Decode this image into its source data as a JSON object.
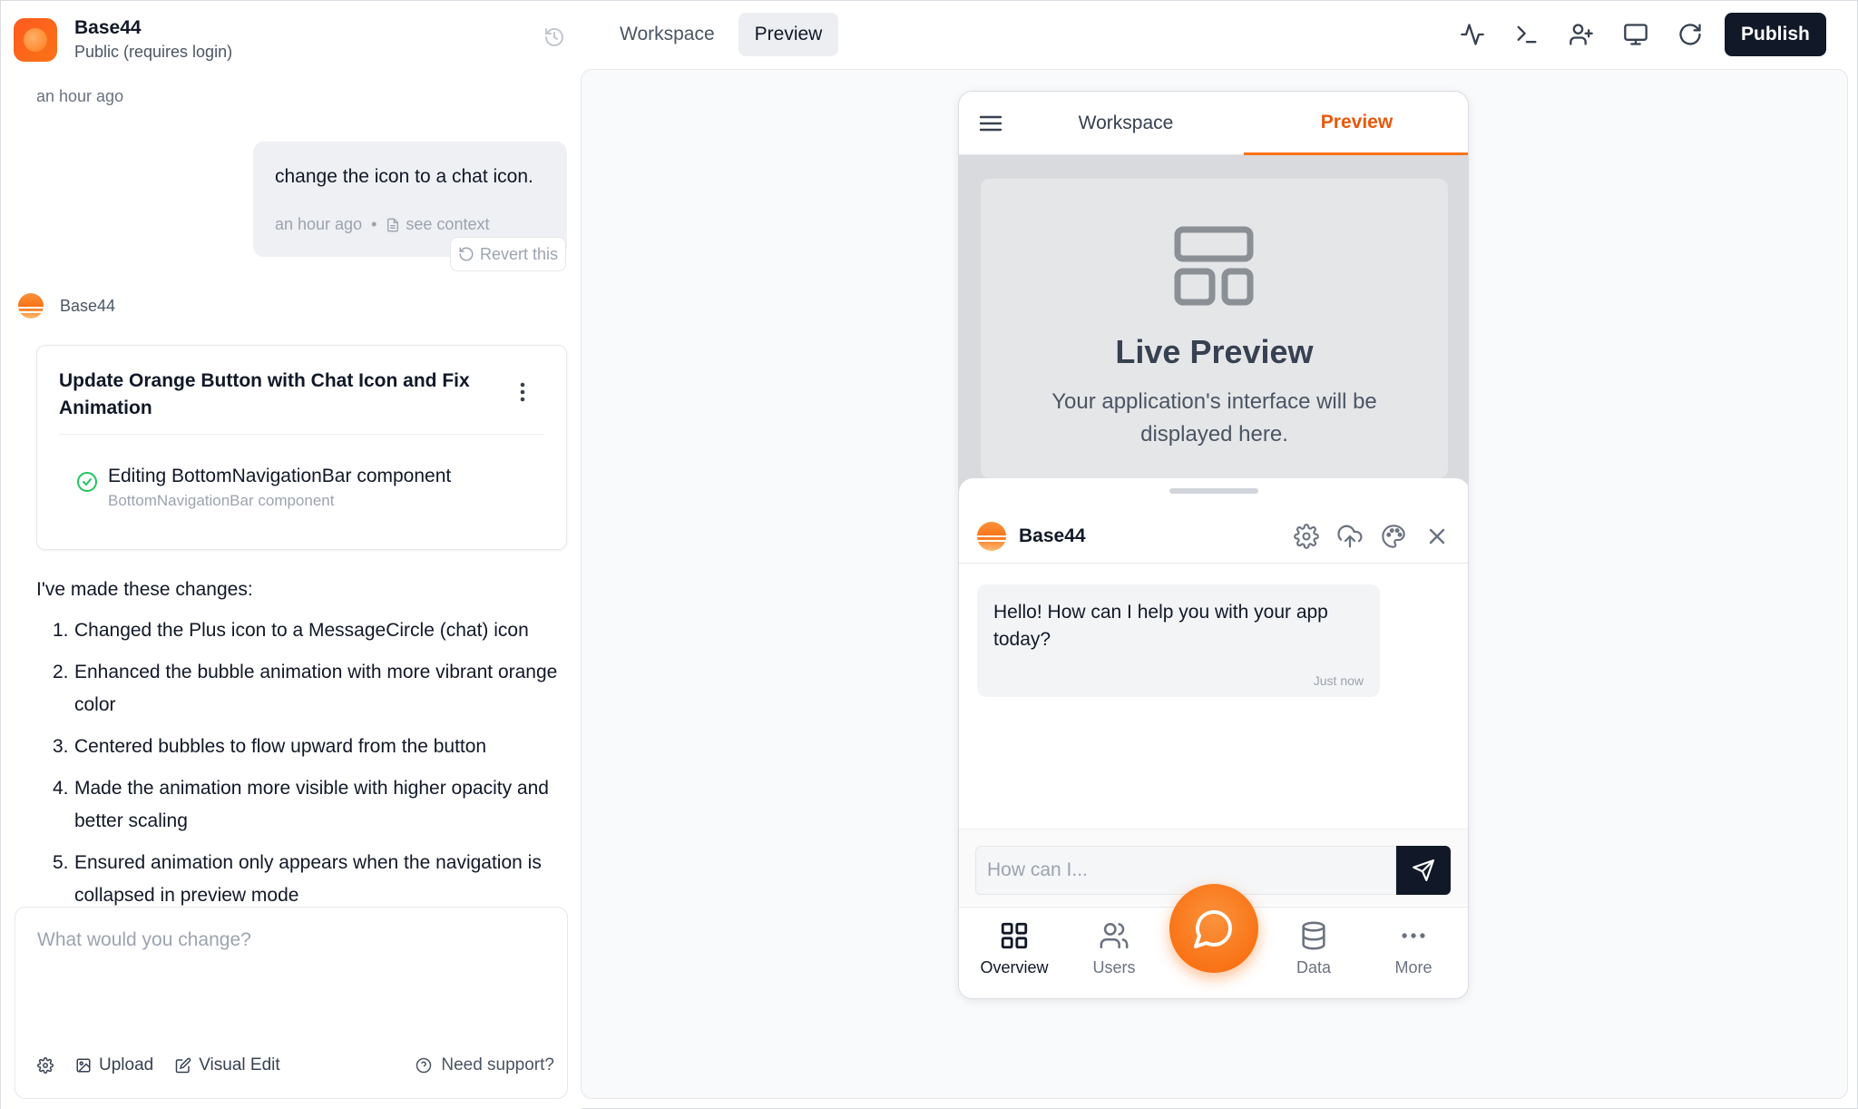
{
  "app": {
    "name": "Base44",
    "visibility": "Public (requires login)"
  },
  "topbar": {
    "tabs": [
      {
        "label": "Workspace",
        "active": false
      },
      {
        "label": "Preview",
        "active": true
      }
    ],
    "icons": [
      "activity-icon",
      "terminal-icon",
      "add-user-icon",
      "monitor-icon",
      "refresh-icon"
    ],
    "publish_label": "Publish"
  },
  "chat": {
    "timestamp_top": "an hour ago",
    "user_message": {
      "text": "change the icon to a chat icon.",
      "time": "an hour ago",
      "separator": "•",
      "context_label": "see context",
      "revert_label": "Revert this"
    },
    "bot": {
      "name": "Base44",
      "card": {
        "title": "Update Orange Button with Chat Icon and Fix Animation",
        "task": "Editing BottomNavigationBar component",
        "task_sub": "BottomNavigationBar component"
      },
      "intro": "I've made these changes:",
      "changes": [
        {
          "num": "1.",
          "text": "Changed the Plus icon to a MessageCircle (chat) icon"
        },
        {
          "num": "2.",
          "text": "Enhanced the bubble animation with more vibrant orange color"
        },
        {
          "num": "3.",
          "text": "Centered bubbles to flow upward from the button"
        },
        {
          "num": "4.",
          "text": "Made the animation more visible with higher opacity and better scaling"
        },
        {
          "num": "5.",
          "text": "Ensured animation only appears when the navigation is collapsed in preview mode"
        }
      ]
    }
  },
  "prompt": {
    "placeholder": "What would you change?",
    "upload_label": "Upload",
    "visual_edit_label": "Visual Edit",
    "support_label": "Need support?"
  },
  "phone": {
    "tabs": {
      "workspace": "Workspace",
      "preview": "Preview"
    },
    "live_preview": {
      "title": "Live Preview",
      "description": "Your application's interface will be displayed here."
    },
    "assistant": {
      "name": "Base44",
      "message": "Hello! How can I help you with your app today?",
      "message_time": "Just now",
      "input_placeholder": "How can I..."
    },
    "bottom_nav": [
      {
        "label": "Overview",
        "icon": "grid-icon",
        "active": true
      },
      {
        "label": "Users",
        "icon": "users-icon",
        "active": false
      },
      {
        "label": "Data",
        "icon": "database-icon",
        "active": false
      },
      {
        "label": "More",
        "icon": "more-icon",
        "active": false
      }
    ]
  },
  "colors": {
    "accent": "#f97316",
    "accent_text": "#ea580c",
    "dark": "#111827",
    "success": "#22c55e"
  }
}
